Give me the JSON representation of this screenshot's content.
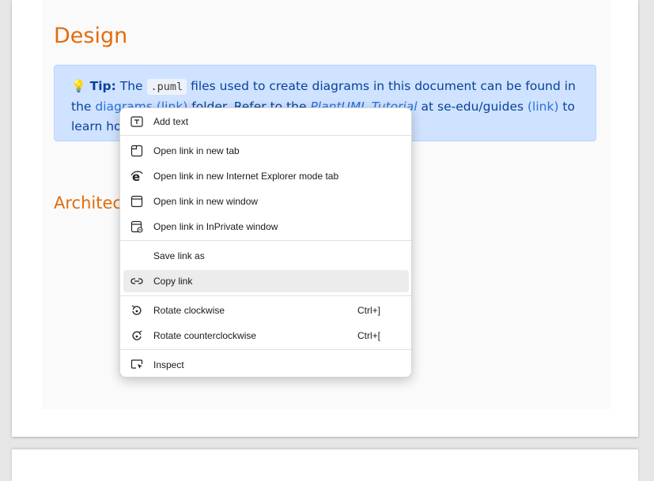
{
  "document": {
    "design_heading": "Design",
    "tip": {
      "bulb": "💡",
      "label": "Tip:",
      "text1": " The ",
      "code": ".puml",
      "text2": " files used to create diagrams in this document can be found in the ",
      "link_diagrams": "diagrams (link)",
      "text3": " folder. Refer to the ",
      "link_tutorial": "PlantUML Tutorial",
      "text4": " at se-edu/guides ",
      "link_link": "(link)",
      "text5": " to learn how to create and edit diagrams."
    },
    "architecture_heading": "Architecture"
  },
  "context_menu": {
    "items": [
      {
        "label": "Add text",
        "icon": "text-box-icon"
      },
      {
        "label": "Open link in new tab",
        "icon": "new-tab-icon"
      },
      {
        "label": "Open link in new Internet Explorer mode tab",
        "icon": "internet-explorer-icon"
      },
      {
        "label": "Open link in new window",
        "icon": "new-window-icon"
      },
      {
        "label": "Open link in InPrivate window",
        "icon": "inprivate-window-icon"
      },
      {
        "label": "Save link as",
        "icon": ""
      },
      {
        "label": "Copy link",
        "icon": "link-icon",
        "highlighted": true
      },
      {
        "label": "Rotate clockwise",
        "icon": "rotate-clockwise-icon",
        "shortcut": "Ctrl+]"
      },
      {
        "label": "Rotate counterclockwise",
        "icon": "rotate-counterclockwise-icon",
        "shortcut": "Ctrl+["
      },
      {
        "label": "Inspect",
        "icon": "inspect-icon"
      }
    ]
  },
  "colors": {
    "heading": "#e46c0a",
    "tip_background": "#cfe2ff",
    "tip_text": "#084298",
    "link": "#2a6fdb",
    "menu_highlight": "#ececec"
  }
}
